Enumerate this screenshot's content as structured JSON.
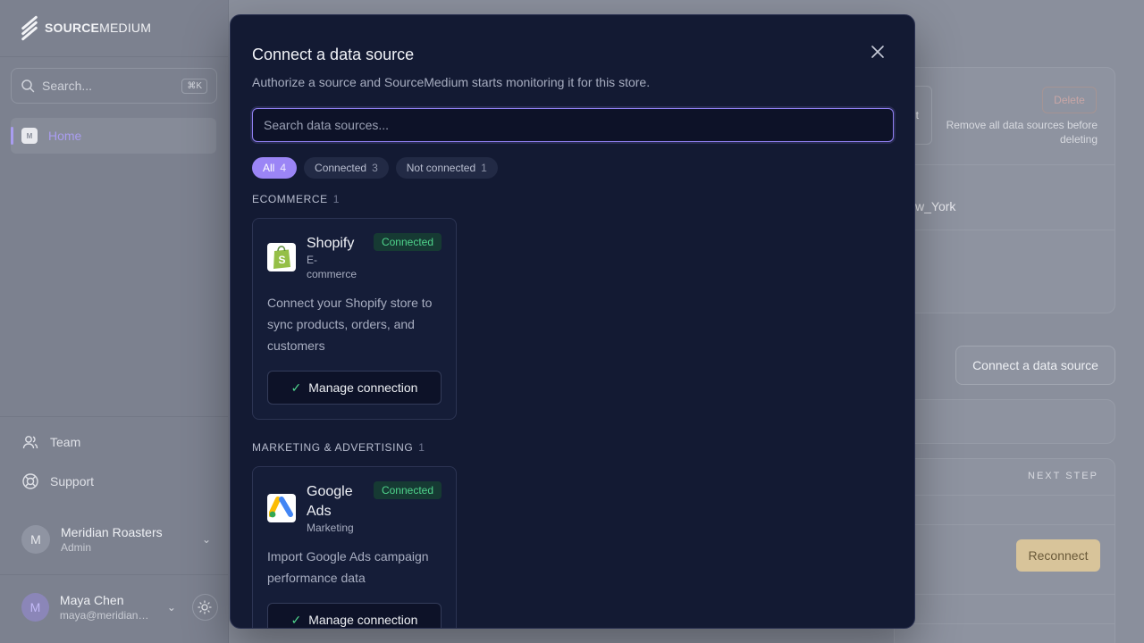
{
  "brand": {
    "name_bold": "SOURCE",
    "name_rest": "MEDIUM"
  },
  "sidebar": {
    "search_placeholder": "Search...",
    "search_shortcut": "⌘K",
    "home_label": "Home",
    "home_badge": "M",
    "team_label": "Team",
    "support_label": "Support",
    "org": {
      "initial": "M",
      "name": "Meridian Roasters",
      "role": "Admin"
    },
    "user": {
      "initial": "M",
      "name": "Maya Chen",
      "email": "maya@meridianroasters.com"
    }
  },
  "background": {
    "delete_label": "Delete",
    "delete_note": "Remove all data sources before deleting",
    "truncated_label": "t",
    "timezone_fragment": "w_York",
    "connect_label": "Connect a data source",
    "next_step_header": "NEXT STEP",
    "reconnect_label": "Reconnect"
  },
  "modal": {
    "title": "Connect a data source",
    "subtitle": "Authorize a source and SourceMedium starts monitoring it for this store.",
    "search_placeholder": "Search data sources...",
    "filters": [
      {
        "label": "All",
        "count": "4",
        "active": true
      },
      {
        "label": "Connected",
        "count": "3",
        "active": false
      },
      {
        "label": "Not connected",
        "count": "1",
        "active": false
      }
    ],
    "sections": [
      {
        "title": "ECOMMERCE",
        "count": "1",
        "cards": [
          {
            "name": "Shopify",
            "category": "E-commerce",
            "status": "Connected",
            "description": "Connect your Shopify store to sync products, orders, and customers",
            "action": "Manage connection",
            "icon": "shopify-icon"
          }
        ]
      },
      {
        "title": "MARKETING & ADVERTISING",
        "count": "1",
        "cards": [
          {
            "name": "Google Ads",
            "category": "Marketing",
            "status": "Connected",
            "description": "Import Google Ads campaign performance data",
            "action": "Manage connection",
            "icon": "google-ads-icon"
          }
        ]
      }
    ]
  },
  "colors": {
    "accent": "#9b85f6",
    "modal_bg": "#131a33",
    "success": "#4fd48c",
    "warning": "#f5c97a"
  }
}
